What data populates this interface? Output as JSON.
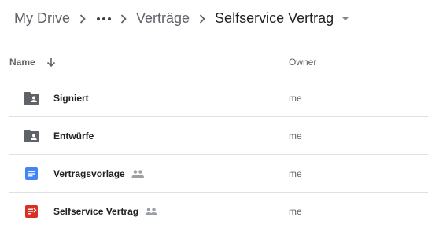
{
  "breadcrumb": {
    "root": "My Drive",
    "more_icon": "more-horiz-icon",
    "parent": "Verträge",
    "current": "Selfservice Vertrag",
    "separator_icon": "chevron-right-icon",
    "dropdown_icon": "arrow-drop-down-icon"
  },
  "columns": {
    "name": "Name",
    "sort_icon": "arrow-down-icon",
    "owner": "Owner"
  },
  "files": [
    {
      "name": "Signiert",
      "type": "shared-folder",
      "icon": "shared-folder-icon",
      "shared": false,
      "owner": "me"
    },
    {
      "name": "Entwürfe",
      "type": "shared-folder",
      "icon": "shared-folder-icon",
      "shared": false,
      "owner": "me"
    },
    {
      "name": "Vertragsvorlage",
      "type": "google-doc",
      "icon": "google-docs-icon",
      "shared": true,
      "owner": "me"
    },
    {
      "name": "Selfservice Vertrag",
      "type": "form",
      "icon": "form-icon",
      "shared": true,
      "owner": "me"
    }
  ],
  "colors": {
    "folder": "#5f6368",
    "doc": "#4285f4",
    "form": "#d93025",
    "text": "#202124",
    "muted": "#5f6368"
  }
}
